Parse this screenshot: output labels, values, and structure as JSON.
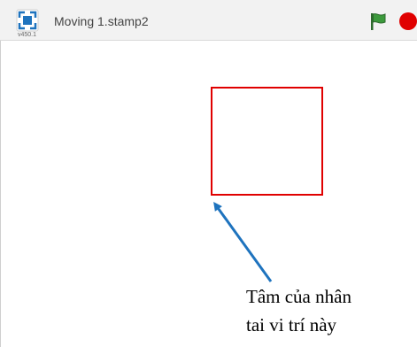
{
  "titlebar": {
    "version": "v450.1",
    "project_title": "Moving 1.stamp2"
  },
  "icons": {
    "fullscreen": "fullscreen-icon",
    "green_flag": "green-flag-icon",
    "stop": "stop-icon"
  },
  "colors": {
    "accent": "#1e73be",
    "sprite_outline": "#e00000",
    "flag": "#2e8b2e",
    "stop": "#e00000"
  },
  "annotation": {
    "line1": "Tâm của nhân",
    "line2": "tai vi trí này"
  }
}
